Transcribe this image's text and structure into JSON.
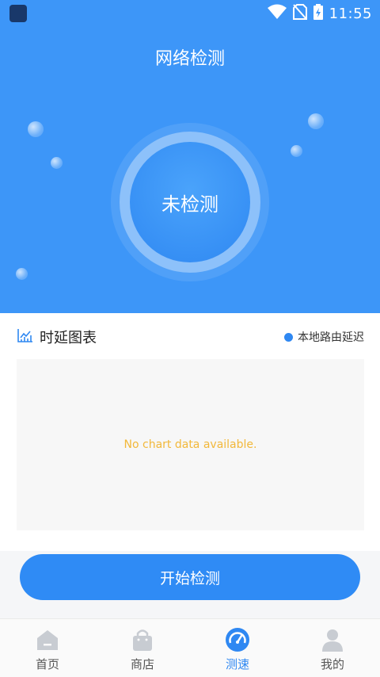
{
  "status_bar": {
    "time": "11:55"
  },
  "header": {
    "title": "网络检测"
  },
  "gauge": {
    "status_text": "未检测"
  },
  "chart_section": {
    "title": "时延图表",
    "legend_label": "本地路由延迟",
    "empty_message": "No chart data available."
  },
  "actions": {
    "start_label": "开始检测"
  },
  "bottom_nav": {
    "items": [
      {
        "label": "首页",
        "icon": "home-icon",
        "active": false
      },
      {
        "label": "商店",
        "icon": "shopping-bag-icon",
        "active": false
      },
      {
        "label": "测速",
        "icon": "speedometer-icon",
        "active": true
      },
      {
        "label": "我的",
        "icon": "user-icon",
        "active": false
      }
    ]
  },
  "colors": {
    "hero_blue": "#3d96f8",
    "accent_blue": "#2f88f2",
    "empty_text": "#f2b83a",
    "inactive_icon": "#c8ccd2"
  }
}
